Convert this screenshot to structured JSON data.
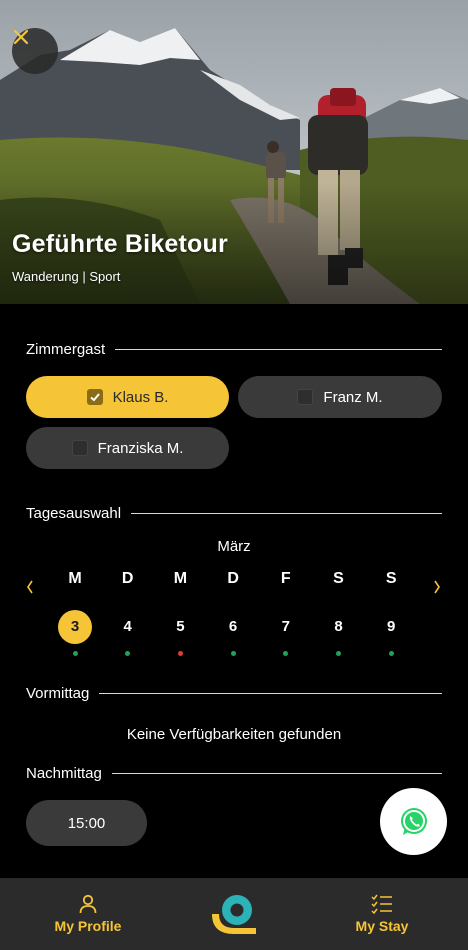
{
  "hero": {
    "title": "Geführte Biketour",
    "subtitle": "Wanderung | Sport",
    "close_icon": "close-icon"
  },
  "guests": {
    "heading": "Zimmergast",
    "items": [
      {
        "label": "Klaus B.",
        "checked": true
      },
      {
        "label": "Franz M.",
        "checked": false
      },
      {
        "label": "Franziska M.",
        "checked": false
      }
    ]
  },
  "days": {
    "heading": "Tagesauswahl",
    "month": "März",
    "prev_icon": "chevron-left-icon",
    "next_icon": "chevron-right-icon",
    "items": [
      {
        "name": "M",
        "num": "3",
        "selected": true,
        "status": "available"
      },
      {
        "name": "D",
        "num": "4",
        "selected": false,
        "status": "available"
      },
      {
        "name": "M",
        "num": "5",
        "selected": false,
        "status": "unavailable"
      },
      {
        "name": "D",
        "num": "6",
        "selected": false,
        "status": "available"
      },
      {
        "name": "F",
        "num": "7",
        "selected": false,
        "status": "available"
      },
      {
        "name": "S",
        "num": "8",
        "selected": false,
        "status": "available"
      },
      {
        "name": "S",
        "num": "9",
        "selected": false,
        "status": "available"
      }
    ]
  },
  "morning": {
    "heading": "Vormittag",
    "empty_text": "Keine Verfügbarkeiten gefunden"
  },
  "afternoon": {
    "heading": "Nachmittag",
    "slots": [
      "15:00"
    ]
  },
  "whatsapp_icon": "whatsapp-icon",
  "nav": {
    "profile_label": "My Profile",
    "stay_label": "My Stay",
    "profile_icon": "user-icon",
    "stay_icon": "checklist-icon",
    "logo": "app-logo"
  },
  "colors": {
    "accent": "#f6c437",
    "chip": "#3a3a3a",
    "available_dot": "#1fa35a",
    "unavailable_dot": "#e03a3a",
    "nav_bg": "#2b2b2b",
    "logo_teal": "#2bb3b8"
  }
}
